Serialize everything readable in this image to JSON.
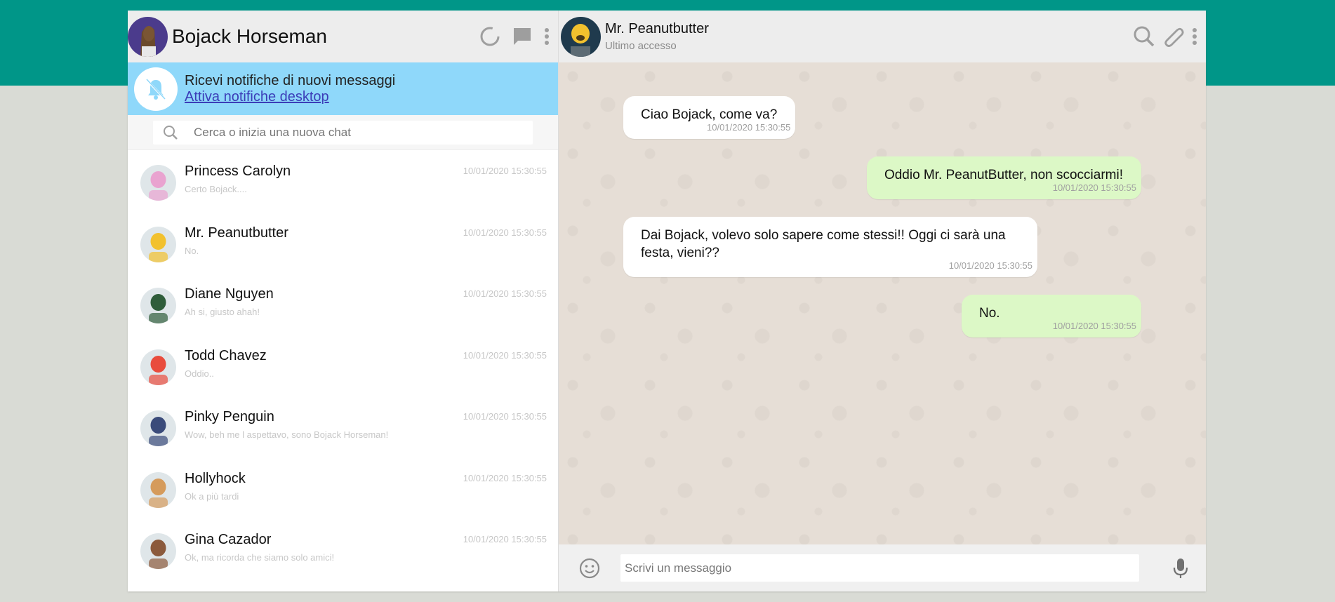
{
  "me": {
    "name": "Bojack Horseman"
  },
  "notifications": {
    "title": "Ricevi notifiche di nuovi messaggi",
    "link": "Attiva notifiche desktop"
  },
  "search": {
    "placeholder": "Cerca o inizia una nuova chat"
  },
  "chats": [
    {
      "name": "Princess Carolyn",
      "last": "Certo Bojack....",
      "time": "10/01/2020 15:30:55",
      "color": "#e9a3d0"
    },
    {
      "name": "Mr. Peanutbutter",
      "last": "No.",
      "time": "10/01/2020 15:30:55",
      "color": "#f2c12e"
    },
    {
      "name": "Diane Nguyen",
      "last": "Ah si, giusto ahah!",
      "time": "10/01/2020 15:30:55",
      "color": "#2f5d3a"
    },
    {
      "name": "Todd Chavez",
      "last": "Oddio..",
      "time": "10/01/2020 15:30:55",
      "color": "#e94c3d"
    },
    {
      "name": "Pinky Penguin",
      "last": "Wow, beh me l aspettavo, sono Bojack Horseman!",
      "time": "10/01/2020 15:30:55",
      "color": "#3a4b7a"
    },
    {
      "name": "Hollyhock",
      "last": "Ok a più tardi",
      "time": "10/01/2020 15:30:55",
      "color": "#d59b5c"
    },
    {
      "name": "Gina Cazador",
      "last": "Ok, ma ricorda che siamo solo amici!",
      "time": "10/01/2020 15:30:55",
      "color": "#8b5a3c"
    }
  ],
  "contact": {
    "name": "Mr. Peanutbutter",
    "status": "Ultimo accesso"
  },
  "messages": [
    {
      "text": "Ciao Bojack, come va?",
      "time": "10/01/2020 15:30:55",
      "dir": "in"
    },
    {
      "text": "Oddio Mr. PeanutButter, non scocciarmi!",
      "time": "10/01/2020 15:30:55",
      "dir": "out"
    },
    {
      "text": "Dai Bojack, volevo solo sapere come stessi!! Oggi ci sarà una festa, vieni??",
      "time": "10/01/2020 15:30:55",
      "dir": "in"
    },
    {
      "text": "No.",
      "time": "10/01/2020 15:30:55",
      "dir": "out"
    }
  ],
  "composer": {
    "placeholder": "Scrivi un messaggio"
  },
  "colors": {
    "brand": "#009688",
    "notify_bg": "#8fd8fa",
    "outgoing": "#dcf8c6",
    "incoming": "#ffffff"
  },
  "icons": [
    "status-icon",
    "new-chat-icon",
    "menu-icon",
    "bell-off-icon",
    "search-icon",
    "attach-icon",
    "emoji-icon",
    "mic-icon"
  ]
}
